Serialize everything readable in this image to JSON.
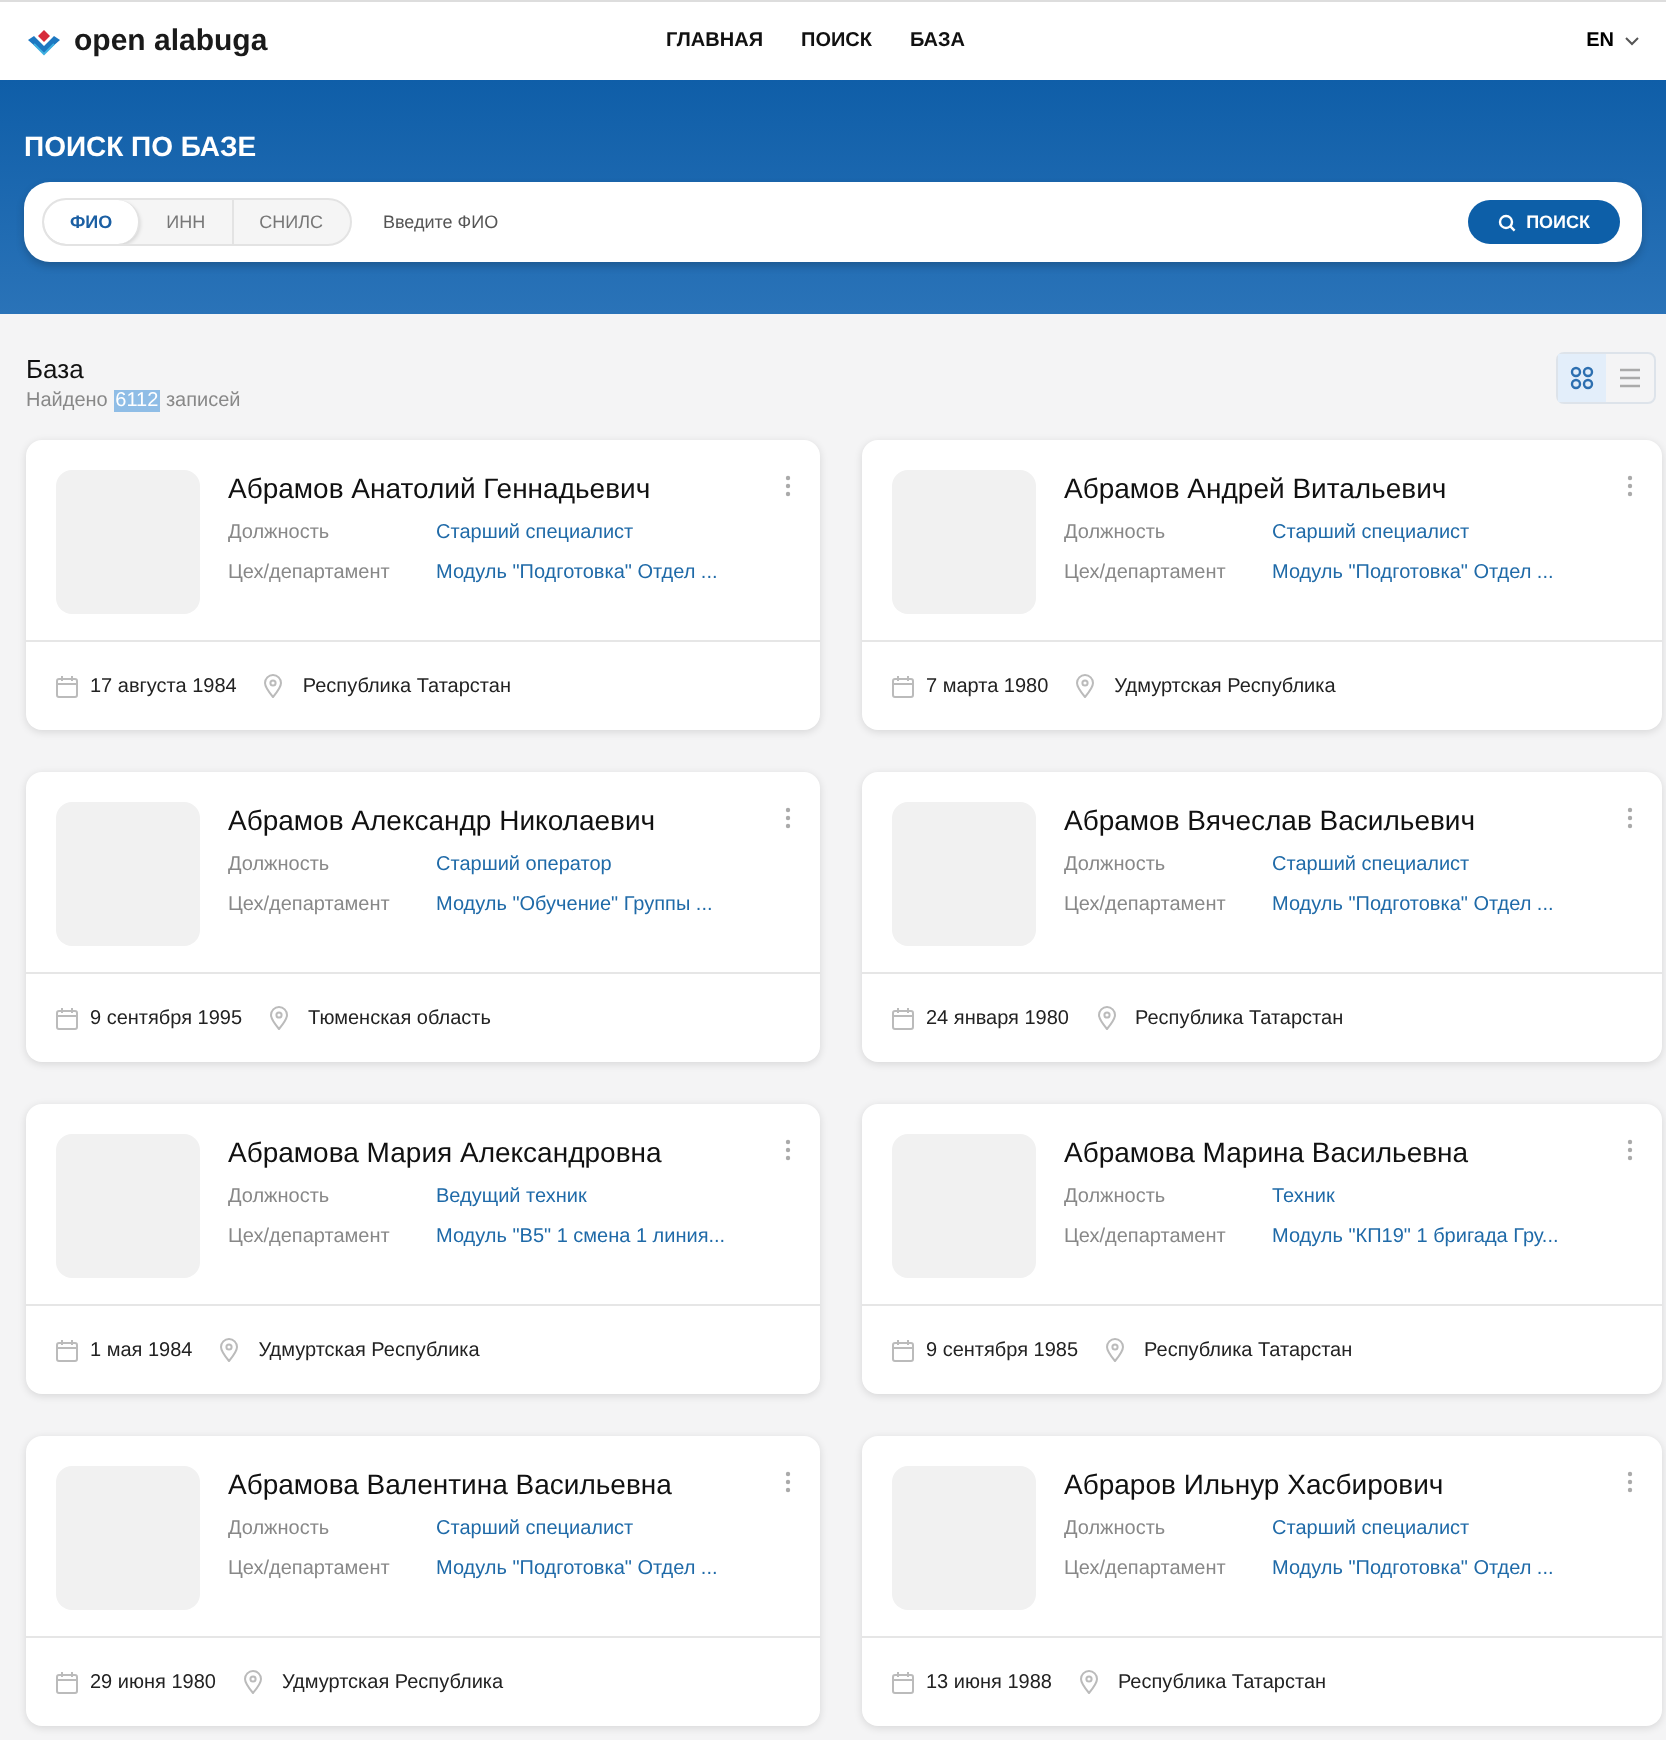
{
  "header": {
    "logo_text": "open alabuga",
    "nav": [
      {
        "label": "ГЛАВНАЯ"
      },
      {
        "label": "ПОИСК"
      },
      {
        "label": "БАЗА"
      }
    ],
    "language": "EN"
  },
  "search": {
    "title": "ПОИСК ПО БАЗЕ",
    "modes": [
      {
        "label": "ФИО",
        "selected": true
      },
      {
        "label": "ИНН",
        "selected": false
      },
      {
        "label": "СНИЛС",
        "selected": false
      }
    ],
    "placeholder": "Введите ФИО",
    "button": "ПОИСК"
  },
  "results": {
    "title": "База",
    "found": [
      {
        "text": "Найдено",
        "highlighted": false
      },
      {
        "text": "6112",
        "highlighted": true
      },
      {
        "text": "записей",
        "highlighted": false
      }
    ],
    "view_modes": [
      {
        "kind": "grid",
        "selected": true
      },
      {
        "kind": "list",
        "selected": false
      }
    ]
  },
  "cards": [
    {
      "name": "Абрамов Анатолий Геннадьевич",
      "fields": [
        {
          "label": "Должность",
          "value": "Старший специалист"
        },
        {
          "label": "Цех/департамент",
          "value": "Модуль \"Подготовка\" Отдел ..."
        }
      ],
      "birth_date": "17 августа 1984",
      "region": "Республика Татарстан"
    },
    {
      "name": "Абрамов Андрей Витальевич",
      "fields": [
        {
          "label": "Должность",
          "value": "Старший специалист"
        },
        {
          "label": "Цех/департамент",
          "value": "Модуль \"Подготовка\" Отдел ..."
        }
      ],
      "birth_date": "7 марта 1980",
      "region": "Удмуртская Республика"
    },
    {
      "name": "Абрамов Александр Николаевич",
      "fields": [
        {
          "label": "Должность",
          "value": "Старший оператор"
        },
        {
          "label": "Цех/департамент",
          "value": "Модуль \"Обучение\" Группы ..."
        }
      ],
      "birth_date": "9 сентября 1995",
      "region": "Тюменская область"
    },
    {
      "name": "Абрамов Вячеслав Васильевич",
      "fields": [
        {
          "label": "Должность",
          "value": "Старший специалист"
        },
        {
          "label": "Цех/департамент",
          "value": "Модуль \"Подготовка\" Отдел ..."
        }
      ],
      "birth_date": "24 января 1980",
      "region": "Республика Татарстан"
    },
    {
      "name": "Абрамова Мария Александровна",
      "fields": [
        {
          "label": "Должность",
          "value": "Ведущий техник"
        },
        {
          "label": "Цех/департамент",
          "value": "Модуль \"В5\" 1 смена 1 линия..."
        }
      ],
      "birth_date": "1 мая 1984",
      "region": "Удмуртская Республика"
    },
    {
      "name": "Абрамова Марина Васильевна",
      "fields": [
        {
          "label": "Должность",
          "value": "Техник"
        },
        {
          "label": "Цех/департамент",
          "value": "Модуль \"КП19\" 1 бригада Гру..."
        }
      ],
      "birth_date": "9 сентября 1985",
      "region": "Республика Татарстан"
    },
    {
      "name": "Абрамова Валентина Васильевна",
      "fields": [
        {
          "label": "Должность",
          "value": "Старший специалист"
        },
        {
          "label": "Цех/департамент",
          "value": "Модуль \"Подготовка\" Отдел ..."
        }
      ],
      "birth_date": "29 июня 1980",
      "region": "Удмуртская Республика"
    },
    {
      "name": "Абраров Ильнур Хасбирович",
      "fields": [
        {
          "label": "Должность",
          "value": "Старший специалист"
        },
        {
          "label": "Цех/департамент",
          "value": "Модуль \"Подготовка\" Отдел ..."
        }
      ],
      "birth_date": "13 июня 1988",
      "region": "Республика Татарстан"
    }
  ]
}
